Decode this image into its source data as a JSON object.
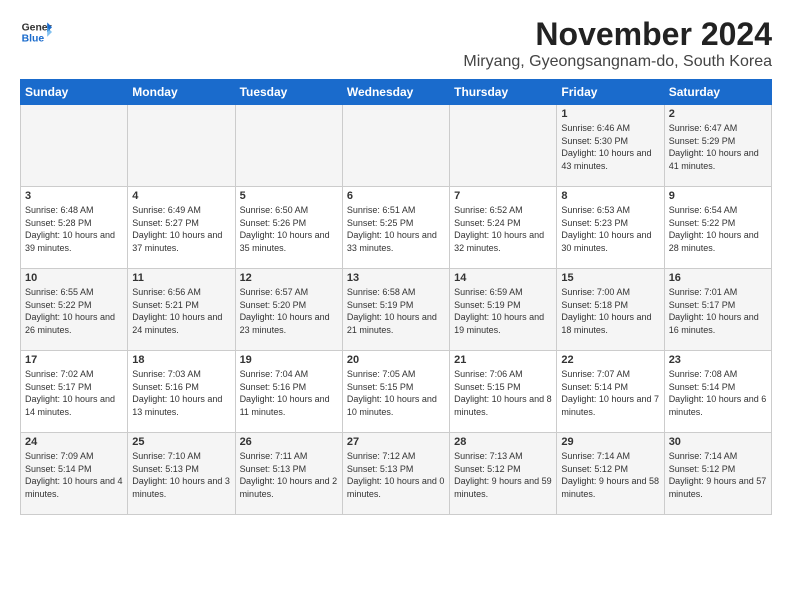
{
  "logo": {
    "line1": "General",
    "line2": "Blue"
  },
  "title": "November 2024",
  "subtitle": "Miryang, Gyeongsangnam-do, South Korea",
  "days_of_week": [
    "Sunday",
    "Monday",
    "Tuesday",
    "Wednesday",
    "Thursday",
    "Friday",
    "Saturday"
  ],
  "weeks": [
    [
      {
        "day": "",
        "content": ""
      },
      {
        "day": "",
        "content": ""
      },
      {
        "day": "",
        "content": ""
      },
      {
        "day": "",
        "content": ""
      },
      {
        "day": "",
        "content": ""
      },
      {
        "day": "1",
        "content": "Sunrise: 6:46 AM\nSunset: 5:30 PM\nDaylight: 10 hours and 43 minutes."
      },
      {
        "day": "2",
        "content": "Sunrise: 6:47 AM\nSunset: 5:29 PM\nDaylight: 10 hours and 41 minutes."
      }
    ],
    [
      {
        "day": "3",
        "content": "Sunrise: 6:48 AM\nSunset: 5:28 PM\nDaylight: 10 hours and 39 minutes."
      },
      {
        "day": "4",
        "content": "Sunrise: 6:49 AM\nSunset: 5:27 PM\nDaylight: 10 hours and 37 minutes."
      },
      {
        "day": "5",
        "content": "Sunrise: 6:50 AM\nSunset: 5:26 PM\nDaylight: 10 hours and 35 minutes."
      },
      {
        "day": "6",
        "content": "Sunrise: 6:51 AM\nSunset: 5:25 PM\nDaylight: 10 hours and 33 minutes."
      },
      {
        "day": "7",
        "content": "Sunrise: 6:52 AM\nSunset: 5:24 PM\nDaylight: 10 hours and 32 minutes."
      },
      {
        "day": "8",
        "content": "Sunrise: 6:53 AM\nSunset: 5:23 PM\nDaylight: 10 hours and 30 minutes."
      },
      {
        "day": "9",
        "content": "Sunrise: 6:54 AM\nSunset: 5:22 PM\nDaylight: 10 hours and 28 minutes."
      }
    ],
    [
      {
        "day": "10",
        "content": "Sunrise: 6:55 AM\nSunset: 5:22 PM\nDaylight: 10 hours and 26 minutes."
      },
      {
        "day": "11",
        "content": "Sunrise: 6:56 AM\nSunset: 5:21 PM\nDaylight: 10 hours and 24 minutes."
      },
      {
        "day": "12",
        "content": "Sunrise: 6:57 AM\nSunset: 5:20 PM\nDaylight: 10 hours and 23 minutes."
      },
      {
        "day": "13",
        "content": "Sunrise: 6:58 AM\nSunset: 5:19 PM\nDaylight: 10 hours and 21 minutes."
      },
      {
        "day": "14",
        "content": "Sunrise: 6:59 AM\nSunset: 5:19 PM\nDaylight: 10 hours and 19 minutes."
      },
      {
        "day": "15",
        "content": "Sunrise: 7:00 AM\nSunset: 5:18 PM\nDaylight: 10 hours and 18 minutes."
      },
      {
        "day": "16",
        "content": "Sunrise: 7:01 AM\nSunset: 5:17 PM\nDaylight: 10 hours and 16 minutes."
      }
    ],
    [
      {
        "day": "17",
        "content": "Sunrise: 7:02 AM\nSunset: 5:17 PM\nDaylight: 10 hours and 14 minutes."
      },
      {
        "day": "18",
        "content": "Sunrise: 7:03 AM\nSunset: 5:16 PM\nDaylight: 10 hours and 13 minutes."
      },
      {
        "day": "19",
        "content": "Sunrise: 7:04 AM\nSunset: 5:16 PM\nDaylight: 10 hours and 11 minutes."
      },
      {
        "day": "20",
        "content": "Sunrise: 7:05 AM\nSunset: 5:15 PM\nDaylight: 10 hours and 10 minutes."
      },
      {
        "day": "21",
        "content": "Sunrise: 7:06 AM\nSunset: 5:15 PM\nDaylight: 10 hours and 8 minutes."
      },
      {
        "day": "22",
        "content": "Sunrise: 7:07 AM\nSunset: 5:14 PM\nDaylight: 10 hours and 7 minutes."
      },
      {
        "day": "23",
        "content": "Sunrise: 7:08 AM\nSunset: 5:14 PM\nDaylight: 10 hours and 6 minutes."
      }
    ],
    [
      {
        "day": "24",
        "content": "Sunrise: 7:09 AM\nSunset: 5:14 PM\nDaylight: 10 hours and 4 minutes."
      },
      {
        "day": "25",
        "content": "Sunrise: 7:10 AM\nSunset: 5:13 PM\nDaylight: 10 hours and 3 minutes."
      },
      {
        "day": "26",
        "content": "Sunrise: 7:11 AM\nSunset: 5:13 PM\nDaylight: 10 hours and 2 minutes."
      },
      {
        "day": "27",
        "content": "Sunrise: 7:12 AM\nSunset: 5:13 PM\nDaylight: 10 hours and 0 minutes."
      },
      {
        "day": "28",
        "content": "Sunrise: 7:13 AM\nSunset: 5:12 PM\nDaylight: 9 hours and 59 minutes."
      },
      {
        "day": "29",
        "content": "Sunrise: 7:14 AM\nSunset: 5:12 PM\nDaylight: 9 hours and 58 minutes."
      },
      {
        "day": "30",
        "content": "Sunrise: 7:14 AM\nSunset: 5:12 PM\nDaylight: 9 hours and 57 minutes."
      }
    ]
  ]
}
